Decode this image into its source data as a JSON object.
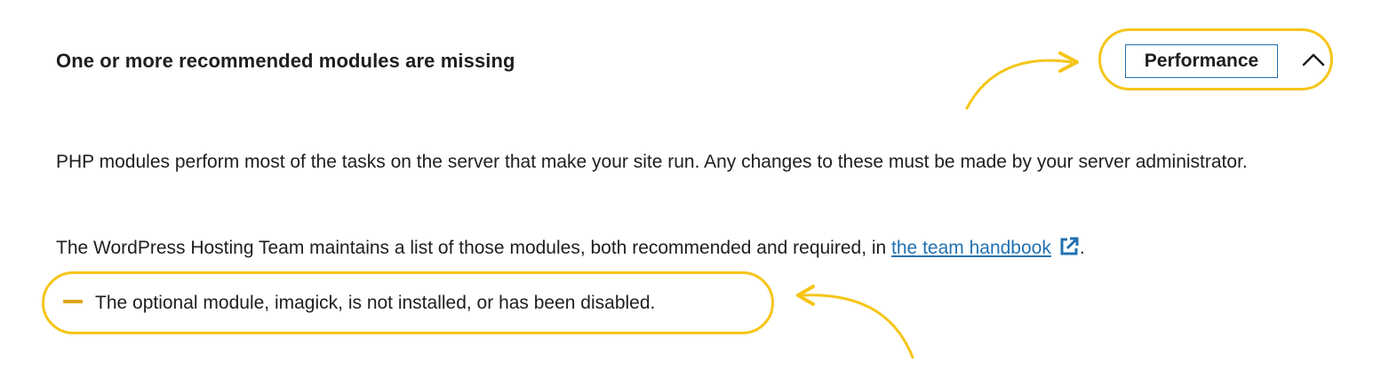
{
  "issue": {
    "title": "One or more recommended modules are missing",
    "badge_label": "Performance",
    "toggle_icon": "chevron-up-icon"
  },
  "description": {
    "paragraph_1": "PHP modules perform most of the tasks on the server that make your site run. Any changes to these must be made by your server administrator.",
    "paragraph_2_before": "The WordPress Hosting Team maintains a list of those modules, both recommended and required, in ",
    "paragraph_2_link": "the team handbook",
    "paragraph_2_after": "."
  },
  "module_list": [
    {
      "status_icon": "dash-icon",
      "text": "The optional module, imagick, is not installed, or has been disabled."
    }
  ],
  "colors": {
    "highlight": "#f5c518",
    "link": "#2271b1",
    "warning_dash": "#dba617",
    "text": "#1e1e1e"
  }
}
